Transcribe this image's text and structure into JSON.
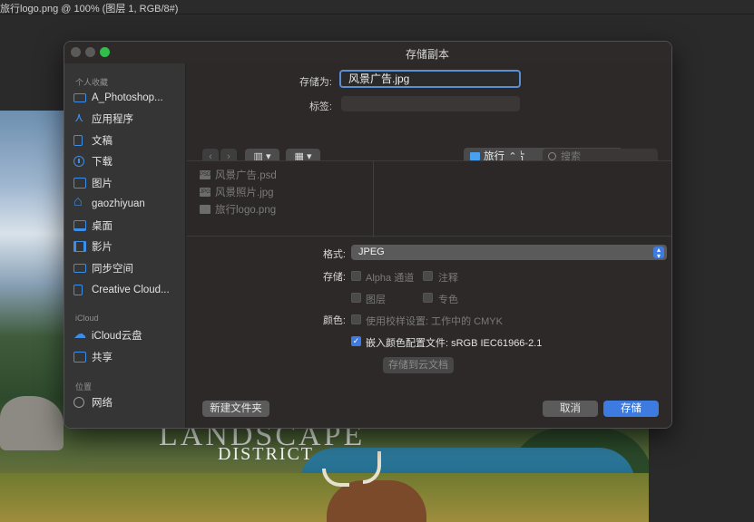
{
  "ps": {
    "doc_title": "旅行logo.png @ 100% (图层 1, RGB/8#)"
  },
  "canvas": {
    "headline": "LANDSCAPE",
    "subtitle": "DISTRICT"
  },
  "dialog": {
    "title": "存储副本",
    "sidebar": {
      "favorites_label": "个人收藏",
      "favorites": [
        {
          "label": "A_Photoshop...",
          "icon": "folder-icon"
        },
        {
          "label": "应用程序",
          "icon": "apps-icon"
        },
        {
          "label": "文稿",
          "icon": "document-icon"
        },
        {
          "label": "下载",
          "icon": "download-icon"
        },
        {
          "label": "图片",
          "icon": "photo-icon"
        },
        {
          "label": "gaozhiyuan",
          "icon": "home-icon"
        },
        {
          "label": "桌面",
          "icon": "desktop-icon"
        },
        {
          "label": "影片",
          "icon": "film-icon"
        },
        {
          "label": "同步空间",
          "icon": "folder-icon"
        },
        {
          "label": "Creative Cloud...",
          "icon": "document-icon"
        }
      ],
      "icloud_label": "iCloud",
      "icloud": [
        {
          "label": "iCloud云盘",
          "icon": "cloud-icon"
        },
        {
          "label": "共享",
          "icon": "shared-folder-icon"
        }
      ],
      "locations_label": "位置",
      "locations": [
        {
          "label": "网络",
          "icon": "globe-icon"
        }
      ]
    },
    "save_as_label": "存储为:",
    "save_as_value": "风景广告.jpg",
    "tags_label": "标签:",
    "tags_value": "",
    "location": "旅行图片",
    "search_placeholder": "搜索",
    "files": [
      {
        "name": "风景广告.psd",
        "badge": "PSD"
      },
      {
        "name": "风景照片.jpg",
        "badge": "JPG"
      },
      {
        "name": "旅行logo.png",
        "badge": ""
      }
    ],
    "format_label": "格式:",
    "format_value": "JPEG",
    "store_label": "存储:",
    "options": {
      "alpha": {
        "label": "Alpha 通道",
        "checked": false
      },
      "notes": {
        "label": "注释",
        "checked": false
      },
      "layers": {
        "label": "图层",
        "checked": false
      },
      "spot": {
        "label": "专色",
        "checked": false
      }
    },
    "color_label": "颜色:",
    "proof": {
      "label": "使用校样设置: 工作中的 CMYK",
      "checked": false
    },
    "embed": {
      "label": "嵌入颜色配置文件: sRGB IEC61966-2.1",
      "checked": true
    },
    "cloud_button": "存储到云文档",
    "new_folder_button": "新建文件夹",
    "cancel_button": "取消",
    "save_button": "存储"
  }
}
